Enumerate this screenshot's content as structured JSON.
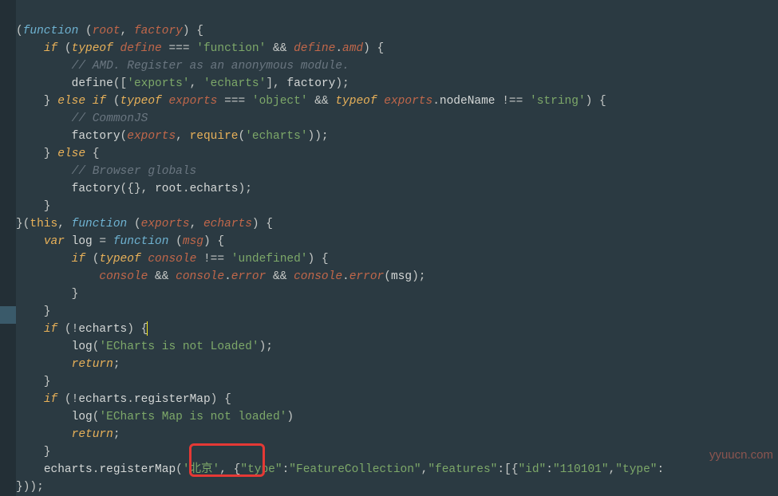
{
  "code": {
    "strings": {
      "function": "'function'",
      "exports": "'exports'",
      "echarts": "'echarts'",
      "object": "'object'",
      "string": "'string'",
      "echarts2": "'echarts'",
      "undefined": "'undefined'",
      "msg_not_loaded": "'ECharts is not Loaded'",
      "msg_map_not_loaded": "'ECharts Map is not loaded'",
      "beijing": "'北京'",
      "type_fc": "\"type\"",
      "val_fc": "\"FeatureCollection\"",
      "features": "\"features\"",
      "id": "\"id\"",
      "id_val": "\"110101\"",
      "type2": "\"type\""
    },
    "comments": {
      "amd": "// AMD. Register as an anonymous module.",
      "commonjs": "// CommonJS",
      "browser": "// Browser globals"
    },
    "kw": {
      "function": "function",
      "if": "if",
      "typeof": "typeof",
      "else": "else",
      "var": "var",
      "return": "return",
      "this": "this"
    },
    "ids": {
      "root": "root",
      "factory": "factory",
      "define": "define",
      "amd": "amd",
      "exports": "exports",
      "nodeName": "nodeName",
      "require": "require",
      "echarts": "echarts",
      "log": "log",
      "msg": "msg",
      "console": "console",
      "error": "error",
      "registerMap": "registerMap"
    }
  },
  "watermark": "yyuucn.com"
}
